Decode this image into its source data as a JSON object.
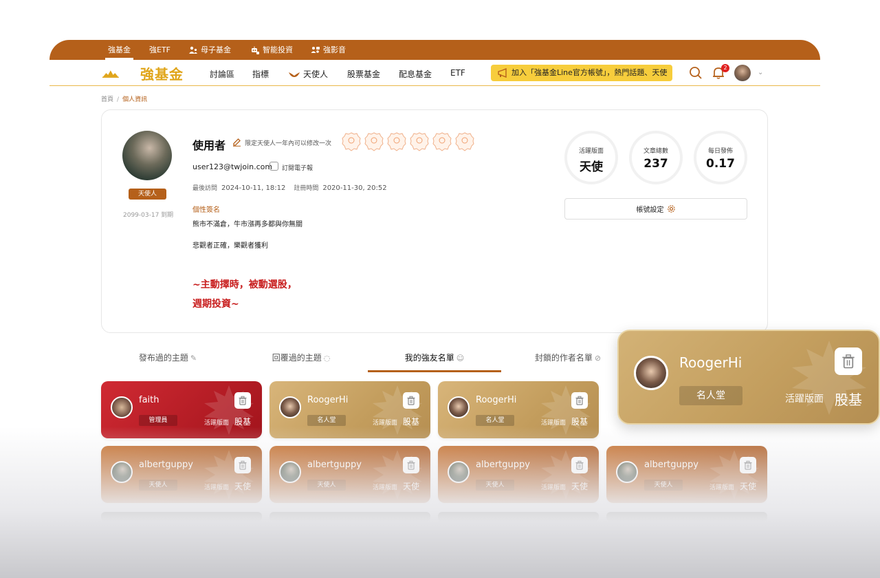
{
  "top_nav": {
    "items": [
      {
        "label": "強基金",
        "icon": ""
      },
      {
        "label": "強ETF",
        "icon": ""
      },
      {
        "label": "母子基金",
        "icon": "parent-child-icon"
      },
      {
        "label": "智能投資",
        "icon": "robot-icon"
      },
      {
        "label": "強影音",
        "icon": "video-people-icon"
      }
    ]
  },
  "header": {
    "logo_text": "強基金",
    "nav": [
      {
        "label": "討論區"
      },
      {
        "label": "指標"
      },
      {
        "label": "天使人",
        "icon": "angel-wings-icon"
      },
      {
        "label": "股票基金"
      },
      {
        "label": "配息基金"
      },
      {
        "label": "ETF"
      }
    ],
    "promo_text": "加入「強基金Line官方帳號」，熱門話題、天使",
    "notification_count": "2"
  },
  "breadcrumb": {
    "home": "首頁",
    "separator": "/",
    "current": "個人資訊"
  },
  "profile": {
    "username": "使用者",
    "edit_note": "限定天使人一年內可以修改一次",
    "role_badge": "天使人",
    "expire": "2099-03-17 到期",
    "email": "user123@twjoin.com",
    "newsletter_label": "訂閱電子報",
    "last_visit_label": "最後訪問",
    "last_visit": "2024-10-11, 18:12",
    "register_label": "註冊時間",
    "register_time": "2020-11-30, 20:52",
    "signature_title": "個性簽名",
    "signature_lines": [
      "熊市不滿倉，牛市漲再多都與你無關",
      "悲觀者正確，樂觀者獲利"
    ],
    "signature_highlight": [
      "~主動擇時，被動選股，",
      "週期投資~"
    ],
    "medals_count": 6,
    "stats": [
      {
        "label": "活躍版面",
        "value": "天使"
      },
      {
        "label": "文章總數",
        "value": "237"
      },
      {
        "label": "每日發佈",
        "value": "0.17"
      }
    ],
    "account_settings_label": "帳號設定"
  },
  "tabs": [
    {
      "label": "發布過的主題",
      "icon": "pencil-icon",
      "active": false
    },
    {
      "label": "回覆過的主題",
      "icon": "comment-icon",
      "active": false
    },
    {
      "label": "我的強友名單",
      "icon": "user-icon",
      "active": true
    },
    {
      "label": "封鎖的作者名單",
      "icon": "block-icon",
      "active": false
    }
  ],
  "friends": [
    {
      "name": "faith",
      "role": "管理員",
      "active_label": "活躍版面",
      "board": "股基",
      "theme": "red"
    },
    {
      "name": "RoogerHi",
      "role": "名人堂",
      "active_label": "活躍版面",
      "board": "股基",
      "theme": "gold"
    },
    {
      "name": "RoogerHi",
      "role": "名人堂",
      "active_label": "活躍版面",
      "board": "股基",
      "theme": "gold"
    },
    {
      "name": "albertguppy",
      "role": "天使人",
      "active_label": "活躍版面",
      "board": "天使",
      "theme": "brown"
    },
    {
      "name": "albertguppy",
      "role": "天使人",
      "active_label": "活躍版面",
      "board": "天使",
      "theme": "brown"
    },
    {
      "name": "albertguppy",
      "role": "天使人",
      "active_label": "活躍版面",
      "board": "天使",
      "theme": "brown"
    },
    {
      "name": "albertguppy",
      "role": "天使人",
      "active_label": "活躍版面",
      "board": "天使",
      "theme": "brown"
    }
  ],
  "zoom_card": {
    "name": "RoogerHi",
    "role": "名人堂",
    "active_label": "活躍版面",
    "board": "股基"
  },
  "colors": {
    "brand": "#b5601a",
    "accent_yellow": "#f7cd3c",
    "admin_red": "#c81e1e",
    "gold": "#c9a566"
  }
}
